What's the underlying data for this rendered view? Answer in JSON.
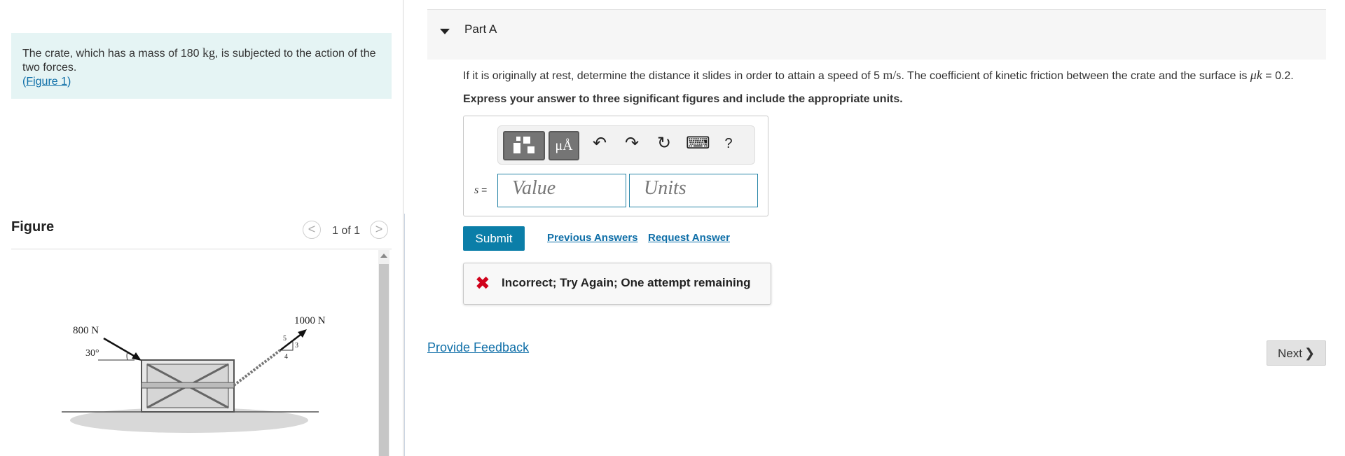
{
  "problem": {
    "text_before": "The crate, which has a mass of 180 ",
    "mass_unit": "kg",
    "text_after": ", is subjected to the action of the two forces.",
    "figure_link_open": "(",
    "figure_link": "Figure 1",
    "figure_link_close": ")"
  },
  "figure": {
    "title": "Figure",
    "counter": "1 of 1",
    "prev_glyph": "<",
    "next_glyph": ">",
    "labels": {
      "force_left": "800 N",
      "angle": "30°",
      "force_right": "1000 N",
      "tri_hyp": "5",
      "tri_side": "3",
      "tri_base": "4"
    }
  },
  "part": {
    "title": "Part A",
    "question_pre": "If it is originally at rest, determine the distance it slides in order to attain a speed of 5 ",
    "speed_unit": "m/s",
    "question_mid": ". The coefficient of kinetic friction between the crate and the surface is ",
    "mu_symbol": "μk",
    "question_post": " = 0.2.",
    "instruction": "Express your answer to three significant figures and include the appropriate units."
  },
  "answer": {
    "var_name": "s",
    "equals": " =",
    "value_placeholder": "Value",
    "units_placeholder": "Units",
    "toolbar": {
      "units_glyph": "μÅ",
      "undo_glyph": "↶",
      "redo_glyph": "↷",
      "reset_glyph": "↻",
      "keyboard_glyph": "⌨",
      "help_glyph": "?"
    }
  },
  "actions": {
    "submit": "Submit",
    "previous_answers": "Previous Answers",
    "request_answer": "Request Answer"
  },
  "feedback": {
    "icon_glyph": "✖",
    "message": "Incorrect; Try Again; One attempt remaining"
  },
  "footer": {
    "provide_feedback": "Provide Feedback",
    "next": "Next",
    "next_glyph": "❯"
  },
  "colors": {
    "accent": "#0b7ea8",
    "problem_bg": "#e5f4f4",
    "error": "#d0021b"
  }
}
